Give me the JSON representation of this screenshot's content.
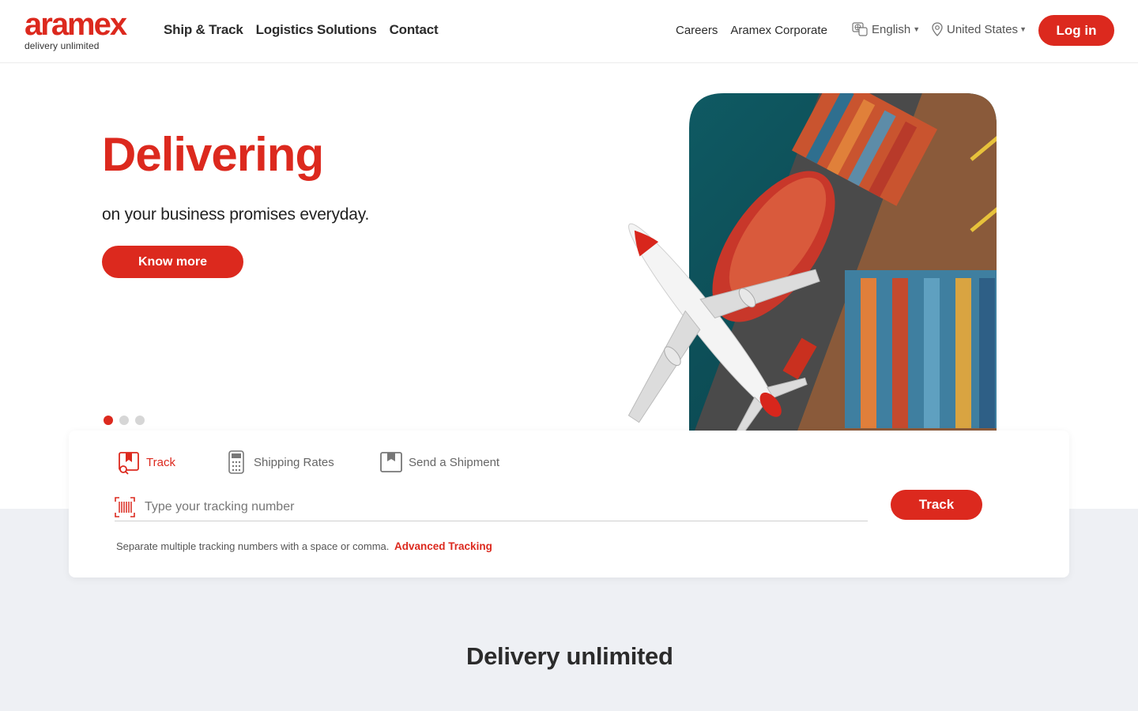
{
  "brand": {
    "logo": "aramex",
    "tagline": "delivery unlimited",
    "accent": "#dc291e"
  },
  "nav": {
    "main": [
      "Ship & Track",
      "Logistics Solutions",
      "Contact"
    ],
    "top_links": [
      "Careers",
      "Aramex Corporate"
    ],
    "language": "English",
    "country": "United States",
    "login": "Log in"
  },
  "hero": {
    "title": "Delivering",
    "subtitle": "on your business promises everyday.",
    "cta": "Know more",
    "slides": 3,
    "active_slide": 1
  },
  "tracking": {
    "tabs": [
      "Track",
      "Shipping Rates",
      "Send a Shipment"
    ],
    "active_tab": "Track",
    "placeholder": "Type your tracking number",
    "button": "Track",
    "hint": "Separate multiple tracking numbers with a space or comma.",
    "advanced_link": "Advanced Tracking"
  },
  "section": {
    "heading": "Delivery unlimited"
  },
  "colors": {
    "band": "#eef0f4"
  }
}
